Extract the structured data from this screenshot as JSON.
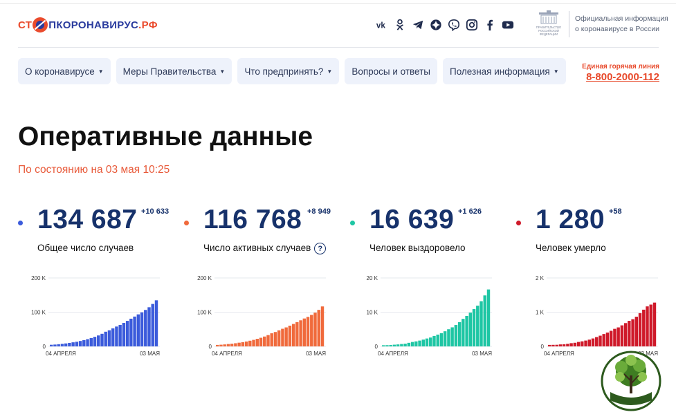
{
  "header": {
    "logo": {
      "part1": "СТ",
      "part2": "ПКОРОНАВИРУС",
      "part3": ".РФ"
    },
    "socials": [
      "vk-icon",
      "odnoklassniki-icon",
      "telegram-icon",
      "yandex-zen-icon",
      "viber-icon",
      "instagram-icon",
      "facebook-icon",
      "youtube-icon"
    ],
    "gov_emblem_lines": [
      "ПРАВИТЕЛЬСТВО",
      "РОССИЙСКОЙ",
      "ФЕДЕРАЦИИ"
    ],
    "gov_text_line1": "Официальная информация",
    "gov_text_line2": "о коронавирусе в России"
  },
  "nav": {
    "items": [
      {
        "label": "О коронавирусе",
        "caret": "▼"
      },
      {
        "label": "Меры Правительства",
        "caret": "▼"
      },
      {
        "label": "Что предпринять?",
        "caret": "▼"
      },
      {
        "label": "Вопросы и ответы",
        "caret": ""
      },
      {
        "label": "Полезная информация",
        "caret": "▼"
      }
    ],
    "hotline_label": "Единая горячая линия",
    "hotline_number": "8-800-2000-112"
  },
  "page": {
    "title": "Оперативные данные",
    "subtitle": "По состоянию на 03 мая 10:25"
  },
  "stats": [
    {
      "value": "134 687",
      "delta": "+10 633",
      "caption": "Общее число случаев",
      "help": "",
      "color": "#3b5bdb"
    },
    {
      "value": "116 768",
      "delta": "+8 949",
      "caption": "Число активных случаев",
      "help": "?",
      "color": "#f06a3c"
    },
    {
      "value": "16 639",
      "delta": "+1 626",
      "caption": "Человек выздоровело",
      "help": "",
      "color": "#1ec6a4"
    },
    {
      "value": "1 280",
      "delta": "+58",
      "caption": "Человек умерло",
      "help": "",
      "color": "#cf1a2a"
    }
  ],
  "chart_data": [
    {
      "type": "bar",
      "title": "",
      "xlabel": "",
      "ylabel": "",
      "x_tick_labels": [
        "04 АПРЕЛЯ",
        "03 МАЯ"
      ],
      "y_ticks": [
        "0",
        "100 K",
        "200 K"
      ],
      "ylim": [
        0,
        200000
      ],
      "grid": true,
      "values": [
        4731,
        5389,
        6343,
        7497,
        8672,
        10131,
        11917,
        13584,
        15770,
        18328,
        21102,
        24490,
        27938,
        32008,
        36793,
        42853,
        47121,
        52763,
        57999,
        62773,
        68622,
        74588,
        80949,
        87147,
        93558,
        99399,
        106498,
        114431,
        124054,
        134687
      ],
      "color": "#3b5bdb"
    },
    {
      "type": "bar",
      "title": "",
      "xlabel": "",
      "ylabel": "",
      "x_tick_labels": [
        "04 АПРЕЛЯ",
        "03 МАЯ"
      ],
      "y_ticks": [
        "0",
        "100 K",
        "200 K"
      ],
      "ylim": [
        0,
        200000
      ],
      "grid": true,
      "values": [
        4300,
        4900,
        5800,
        6900,
        7900,
        9200,
        10800,
        12300,
        14300,
        16600,
        19100,
        22100,
        25200,
        28800,
        33000,
        38300,
        42000,
        47000,
        51500,
        55500,
        60600,
        65600,
        71000,
        76200,
        81500,
        86200,
        92000,
        98500,
        106700,
        116768
      ],
      "color": "#f06a3c"
    },
    {
      "type": "bar",
      "title": "",
      "xlabel": "",
      "ylabel": "",
      "x_tick_labels": [
        "04 АПРЕЛЯ",
        "03 МАЯ"
      ],
      "y_ticks": [
        "0",
        "10 K",
        "20 K"
      ],
      "ylim": [
        0,
        20000
      ],
      "grid": true,
      "values": [
        333,
        355,
        398,
        494,
        580,
        698,
        795,
        1045,
        1291,
        1470,
        1694,
        1986,
        2304,
        2590,
        3057,
        3446,
        3873,
        4420,
        5010,
        5568,
        6250,
        7080,
        8050,
        8900,
        9850,
        10900,
        11900,
        13200,
        14900,
        16639
      ],
      "color": "#1ec6a4"
    },
    {
      "type": "bar",
      "title": "",
      "xlabel": "",
      "ylabel": "",
      "x_tick_labels": [
        "04 АПРЕЛЯ",
        "03 МАЯ"
      ],
      "y_ticks": [
        "0",
        "1 K",
        "2 K"
      ],
      "ylim": [
        0,
        2000
      ],
      "grid": true,
      "values": [
        43,
        45,
        47,
        58,
        63,
        76,
        94,
        106,
        130,
        148,
        170,
        198,
        232,
        273,
        313,
        361,
        405,
        456,
        513,
        555,
        615,
        681,
        747,
        794,
        867,
        972,
        1073,
        1169,
        1222,
        1280
      ],
      "color": "#cf1a2a"
    }
  ]
}
